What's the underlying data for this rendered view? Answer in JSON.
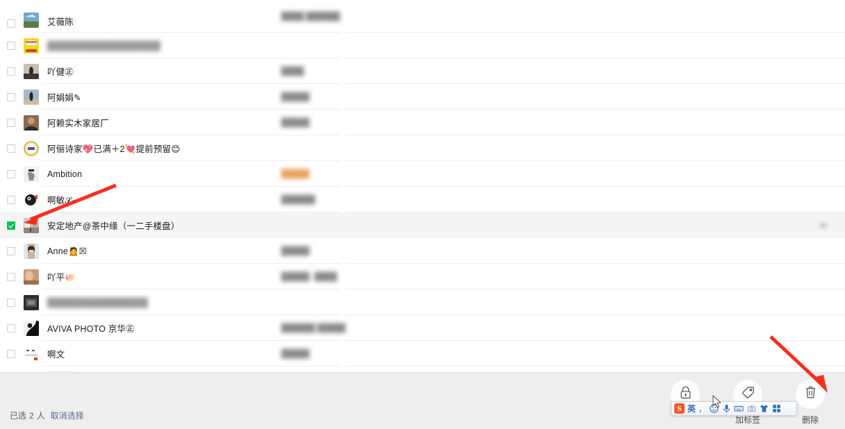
{
  "app": {
    "name": "wechat-contacts-multiselect"
  },
  "list": {
    "rows": [
      {
        "name": "艾薇陈",
        "blurred": false,
        "meta": "████  ██████",
        "meta_color": "gray",
        "avatar": "landscape-sky",
        "checked": false,
        "trailing_icon": false
      },
      {
        "name": "██████████████████",
        "blurred": true,
        "meta": "",
        "meta_color": "gray",
        "avatar": "yellow-poster",
        "checked": false,
        "trailing_icon": false
      },
      {
        "name": "吖健㊣",
        "blurred": false,
        "meta": "████",
        "meta_color": "gray",
        "avatar": "beach-silhouette",
        "checked": false,
        "trailing_icon": false
      },
      {
        "name": "阿娟娟✎",
        "blurred": false,
        "meta": "█████",
        "meta_color": "gray",
        "avatar": "seaside-person",
        "checked": false,
        "trailing_icon": false
      },
      {
        "name": "阿赖实木家居厂",
        "blurred": false,
        "meta": "█████",
        "meta_color": "gray",
        "avatar": "portrait-man",
        "checked": false,
        "trailing_icon": false
      },
      {
        "name": "阿俪诗家💖已满＋2💘提前预留😊",
        "blurred": false,
        "meta": "",
        "meta_color": "gray",
        "avatar": "gold-badge",
        "checked": false,
        "trailing_icon": false
      },
      {
        "name": "Ambition",
        "blurred": false,
        "meta": "█████",
        "meta_color": "orange",
        "avatar": "sketch-figure",
        "checked": false,
        "trailing_icon": false
      },
      {
        "name": "啊敏𝒮𝓊",
        "blurred": false,
        "meta": "██████",
        "meta_color": "gray",
        "avatar": "cartoon-face",
        "checked": false,
        "trailing_icon": false
      },
      {
        "name": "安定地产@茶中缘（一二手楼盘）",
        "blurred": false,
        "meta": "",
        "meta_color": "gray",
        "avatar": "street-scene",
        "checked": true,
        "trailing_icon": true
      },
      {
        "name": "Anne🙍☒",
        "blurred": false,
        "meta": "█████",
        "meta_color": "gray",
        "avatar": "girl-portrait",
        "checked": false,
        "trailing_icon": false
      },
      {
        "name": "吖平🐖",
        "blurred": false,
        "meta": "█████ ·████",
        "meta_color": "gray",
        "avatar": "warm-blur",
        "checked": false,
        "trailing_icon": false
      },
      {
        "name": "████████████████",
        "blurred": true,
        "meta": "",
        "meta_color": "gray",
        "avatar": "dark-photo",
        "checked": false,
        "trailing_icon": false
      },
      {
        "name": "AVIVA PHOTO 京华㊣",
        "blurred": false,
        "meta": "██████  █████",
        "meta_color": "gray",
        "avatar": "bw-portrait",
        "checked": false,
        "trailing_icon": false
      },
      {
        "name": "啊文",
        "blurred": false,
        "meta": "█████",
        "meta_color": "gray",
        "avatar": "white-card",
        "checked": false,
        "trailing_icon": false
      },
      {
        "name": "█████",
        "blurred": true,
        "meta": "",
        "meta_color": "gray",
        "avatar": "pale-blur",
        "checked": false,
        "trailing_icon": false
      }
    ]
  },
  "footer": {
    "selection_prefix": "已选",
    "selection_count": "2",
    "selection_suffix": "人",
    "cancel_label": "取消选择",
    "actions": [
      {
        "icon": "lock-icon",
        "label": ""
      },
      {
        "icon": "tag-icon",
        "label": "加标签"
      },
      {
        "icon": "trash-icon",
        "label": "删除"
      }
    ]
  },
  "ime": {
    "logo_text": "S",
    "mode_label": "英",
    "punct_label": "，",
    "icons": [
      "emoji-icon",
      "microphone-icon",
      "keyboard-icon",
      "screenshot-icon",
      "skin-icon",
      "toolbox-icon"
    ]
  },
  "colors": {
    "checkbox_checked": "#07c160",
    "link": "#576b95",
    "annotation_arrow": "#f52f20",
    "row_selected_bg": "#f5f5f5",
    "footer_bg": "#eeeeee",
    "divider": "#ededed"
  }
}
